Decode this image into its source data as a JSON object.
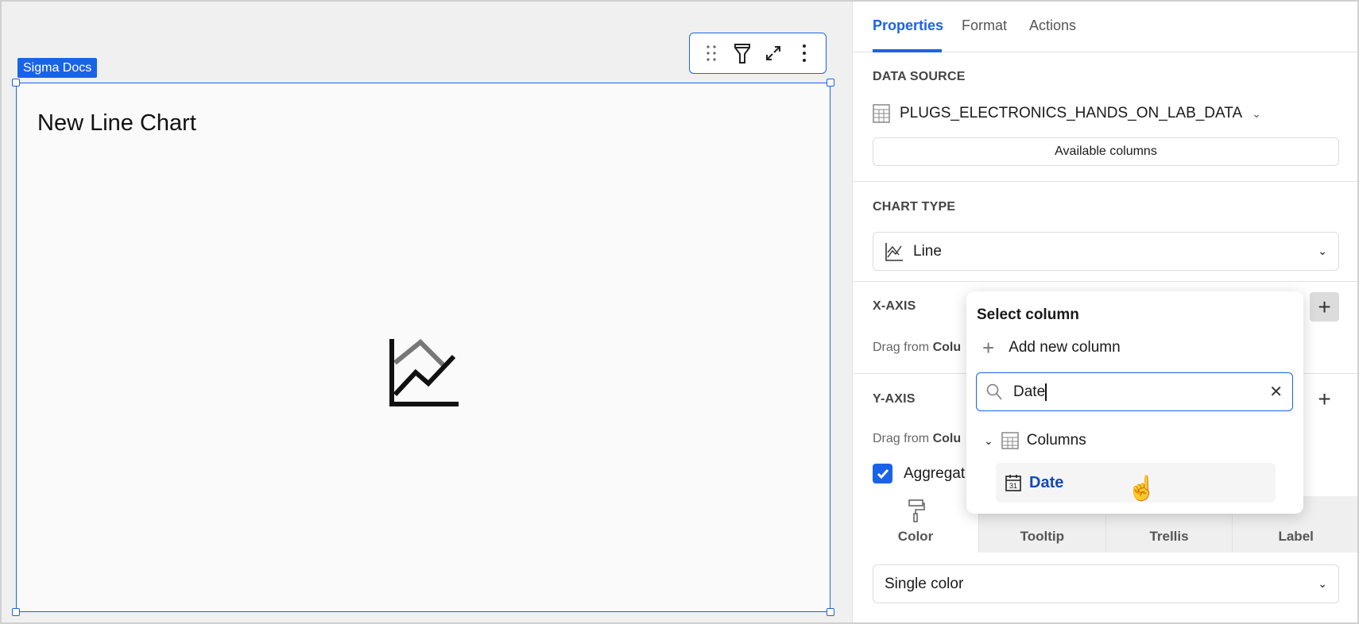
{
  "canvas": {
    "element_tag": "Sigma Docs",
    "chart_title": "New Line Chart"
  },
  "toolbar": {
    "icons": [
      "drag-handle-icon",
      "filter-icon",
      "expand-icon",
      "more-icon"
    ]
  },
  "panel": {
    "tabs": [
      "Properties",
      "Format",
      "Actions"
    ],
    "data_source": {
      "heading": "DATA SOURCE",
      "name": "PLUGS_ELECTRONICS_HANDS_ON_LAB_DATA",
      "button": "Available columns"
    },
    "chart_type": {
      "heading": "CHART TYPE",
      "value": "Line"
    },
    "x_axis": {
      "heading": "X-AXIS",
      "hint_prefix": "Drag from ",
      "hint_bold": "Colu"
    },
    "y_axis": {
      "heading": "Y-AXIS",
      "hint_prefix": "Drag from ",
      "hint_bold": "Colu",
      "aggregate_label": "Aggregat"
    },
    "mark_tabs": [
      "Color",
      "Tooltip",
      "Trellis",
      "Label"
    ],
    "color_select": "Single color"
  },
  "popup": {
    "title": "Select column",
    "add_new": "Add new column",
    "search_value": "Date",
    "group": "Columns",
    "result": "Date"
  },
  "colors": {
    "accent": "#1a63e8"
  }
}
